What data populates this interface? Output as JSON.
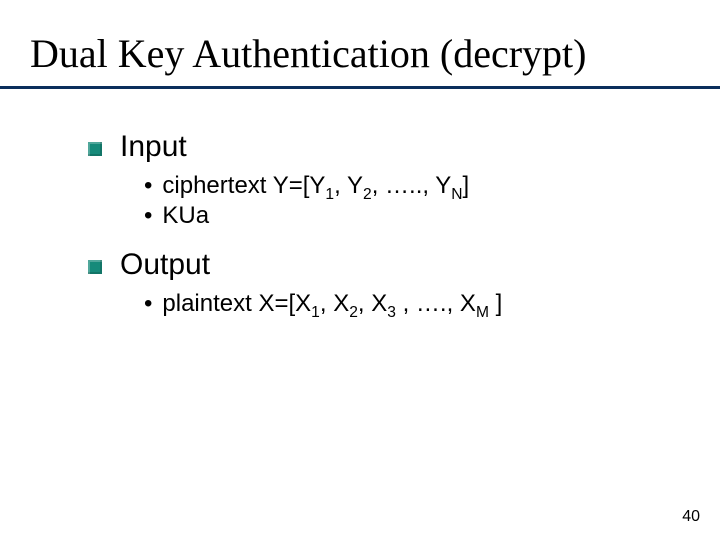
{
  "title": "Dual Key Authentication (decrypt)",
  "sections": [
    {
      "heading": "Input",
      "items": [
        {
          "prefix": "ciphertext Y=[Y",
          "sub1": "1",
          "mid1": ", Y",
          "sub2": "2",
          "mid2": ", ….., Y",
          "sub3": "N",
          "suffix": "]"
        },
        {
          "prefix": "KUa"
        }
      ]
    },
    {
      "heading": "Output",
      "items": [
        {
          "prefix": "plaintext X=[X",
          "sub1": "1",
          "mid1": ", X",
          "sub2": "2",
          "mid2": ",  X",
          "sub3": "3",
          "mid3": " , …., X",
          "sub4": "M",
          "suffix": " ]"
        }
      ]
    }
  ],
  "page_number": "40",
  "colors": {
    "underline": "#0a2f5c",
    "bullet": "#168a7a"
  }
}
